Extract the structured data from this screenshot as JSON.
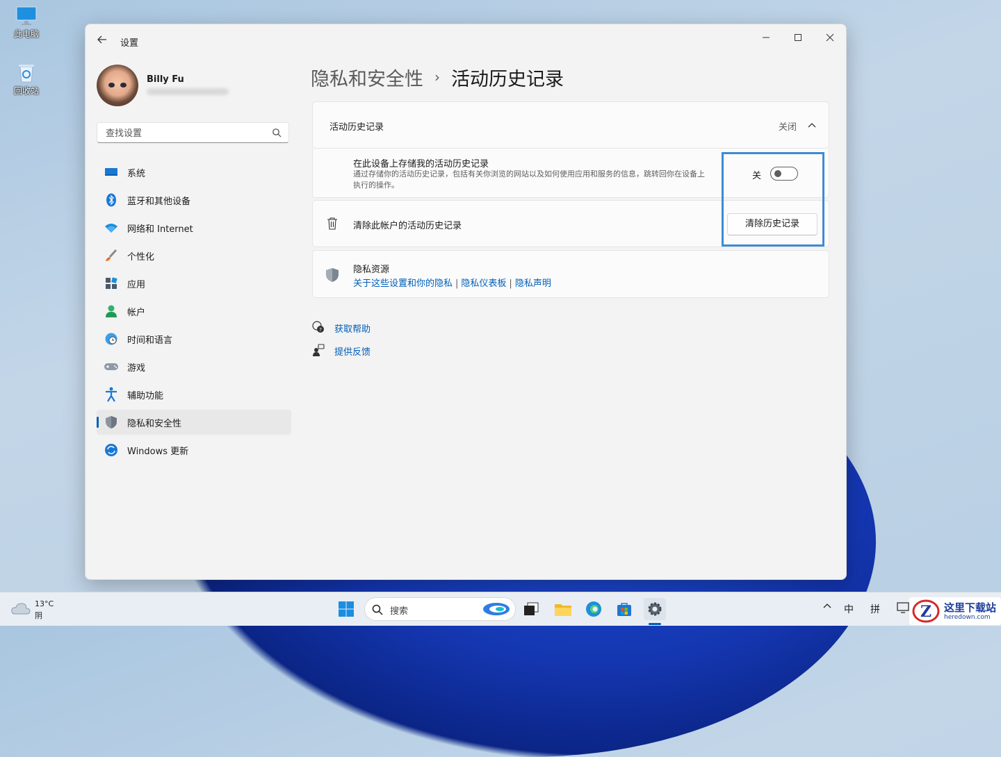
{
  "desktop": {
    "icons": [
      {
        "label": "此电脑"
      },
      {
        "label": "回收站"
      }
    ]
  },
  "window": {
    "app_title": "设置",
    "controls": {
      "minimize": "—",
      "maximize": "☐",
      "close": "✕"
    }
  },
  "profile": {
    "name": "Billy Fu"
  },
  "search": {
    "placeholder": "查找设置"
  },
  "sidebar": {
    "items": [
      {
        "label": "系统",
        "icon": "system-icon"
      },
      {
        "label": "蓝牙和其他设备",
        "icon": "bluetooth-icon"
      },
      {
        "label": "网络和 Internet",
        "icon": "wifi-icon"
      },
      {
        "label": "个性化",
        "icon": "brush-icon"
      },
      {
        "label": "应用",
        "icon": "apps-icon"
      },
      {
        "label": "帐户",
        "icon": "account-icon"
      },
      {
        "label": "时间和语言",
        "icon": "globe-clock-icon"
      },
      {
        "label": "游戏",
        "icon": "gamepad-icon"
      },
      {
        "label": "辅助功能",
        "icon": "accessibility-icon"
      },
      {
        "label": "隐私和安全性",
        "icon": "shield-icon",
        "active": true
      },
      {
        "label": "Windows 更新",
        "icon": "update-icon"
      }
    ]
  },
  "breadcrumb": {
    "parent": "隐私和安全性",
    "separator": "›",
    "current": "活动历史记录"
  },
  "main": {
    "section_header": {
      "title": "活动历史记录",
      "state": "关闭"
    },
    "store_setting": {
      "title": "在此设备上存储我的活动历史记录",
      "description_line1": "通过存储你的活动历史记录，包括有关你浏览的网站以及如何使用应用和服务的信息，跳转回你在设备上",
      "description_line2": "执行的操作。",
      "toggle_label": "关",
      "toggle_on": false
    },
    "clear_setting": {
      "title": "清除此帐户的活动历史记录",
      "button_label": "清除历史记录"
    },
    "privacy_resources": {
      "title": "隐私资源",
      "links": [
        "关于这些设置和你的隐私",
        "隐私仪表板",
        "隐私声明"
      ],
      "link_separator": "|"
    },
    "help_links": [
      {
        "label": "获取帮助",
        "icon": "help-icon"
      },
      {
        "label": "提供反馈",
        "icon": "feedback-icon"
      }
    ]
  },
  "taskbar": {
    "weather_temp": "13°C",
    "weather_condition": "阴",
    "search_label": "搜索",
    "ime_lang": "中",
    "ime_mode": "拼",
    "tray_chevron": "^"
  },
  "watermark": {
    "title": "这里下载站",
    "url": "heredown.com"
  },
  "colors": {
    "accent": "#005fb8",
    "highlight_box": "#3d8bd4"
  }
}
